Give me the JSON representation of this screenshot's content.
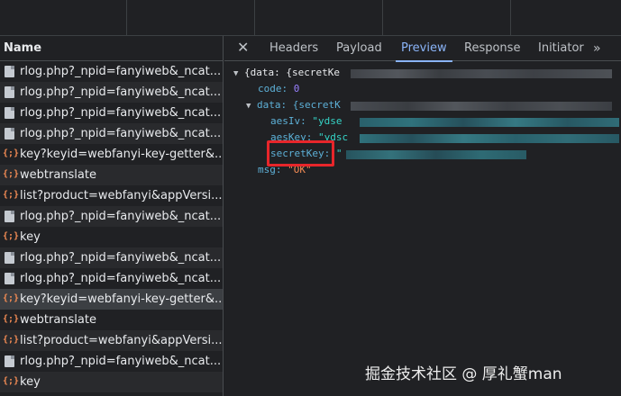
{
  "left_panel": {
    "header": "Name",
    "rows": [
      {
        "type": "doc",
        "label": "rlog.php?_npid=fanyiweb&_ncat..."
      },
      {
        "type": "doc",
        "label": "rlog.php?_npid=fanyiweb&_ncat..."
      },
      {
        "type": "doc",
        "label": "rlog.php?_npid=fanyiweb&_ncat..."
      },
      {
        "type": "doc",
        "label": "rlog.php?_npid=fanyiweb&_ncat..."
      },
      {
        "type": "xhr",
        "label": "key?keyid=webfanyi-key-getter&..."
      },
      {
        "type": "xhr",
        "label": "webtranslate"
      },
      {
        "type": "xhr",
        "label": "list?product=webfanyi&appVersi..."
      },
      {
        "type": "doc",
        "label": "rlog.php?_npid=fanyiweb&_ncat..."
      },
      {
        "type": "xhr",
        "label": "key"
      },
      {
        "type": "doc",
        "label": "rlog.php?_npid=fanyiweb&_ncat..."
      },
      {
        "type": "doc",
        "label": "rlog.php?_npid=fanyiweb&_ncat..."
      },
      {
        "type": "xhr",
        "label": "key?keyid=webfanyi-key-getter&..."
      },
      {
        "type": "xhr",
        "label": "webtranslate"
      },
      {
        "type": "xhr",
        "label": "list?product=webfanyi&appVersi..."
      },
      {
        "type": "doc",
        "label": "rlog.php?_npid=fanyiweb&_ncat..."
      },
      {
        "type": "xhr",
        "label": "key"
      }
    ],
    "xhr_icon_glyph": "{;}",
    "selected_index": 11
  },
  "tabs": {
    "close_glyph": "✕",
    "items": [
      "Headers",
      "Payload",
      "Preview",
      "Response",
      "Initiator"
    ],
    "active": "Preview",
    "more_glyph": "»"
  },
  "preview": {
    "root_toggle": "▼",
    "root_open": "{data: {secretKe",
    "code_key": "code:",
    "code_value": "0",
    "data_toggle": "▼",
    "data_open": "data: {secretK",
    "aesIv_key": "aesIv:",
    "aesIv_value": "\"ydse",
    "aesKey_key": "aesKey:",
    "aesKey_value": "\"ydsc",
    "secretKey_key": "secretKey:",
    "secretKey_value": "\"",
    "msg_key": "msg:",
    "msg_value": "\"OK\""
  },
  "watermark": "掘金技术社区 @ 厚礼蟹man"
}
